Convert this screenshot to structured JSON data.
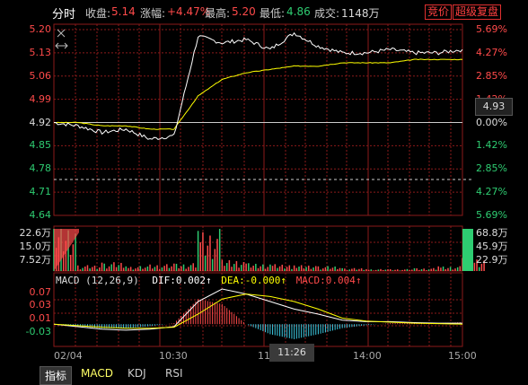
{
  "header": {
    "tab": "分时",
    "close_label": "收盘:",
    "close_value": "5.14",
    "change_label": "涨幅:",
    "change_value": "+4.47%",
    "high_label": "最高:",
    "high_value": "5.20",
    "low_label": "最低:",
    "low_value": "4.86",
    "volume_label": "成交:",
    "volume_value": "1148万",
    "bid_button": "竞价",
    "superlevel_button": "超级复盘"
  },
  "price_axis": {
    "left": [
      "5.20",
      "5.13",
      "5.06",
      "4.99",
      "4.92",
      "4.85",
      "4.78",
      "4.71",
      "4.64"
    ],
    "right": [
      "5.69%",
      "4.27%",
      "2.85%",
      "1.42%",
      "0.00%",
      "1.42%",
      "2.85%",
      "4.27%",
      "5.69%"
    ],
    "right_colors": [
      "#ff4a4a",
      "#ff4a4a",
      "#ff4a4a",
      "#ff4a4a",
      "#dddddd",
      "#2ecc71",
      "#2ecc71",
      "#2ecc71",
      "#2ecc71"
    ],
    "left_colors": [
      "#ff4a4a",
      "#ff4a4a",
      "#ff4a4a",
      "#ff4a4a",
      "#dddddd",
      "#2ecc71",
      "#2ecc71",
      "#2ecc71",
      "#2ecc71"
    ]
  },
  "crosshair_price": "4.93",
  "volume_axis": {
    "left": [
      "22.6万",
      "15.0万",
      "7.52万"
    ],
    "right": [
      "68.8万",
      "45.9万",
      "22.9万"
    ]
  },
  "macd": {
    "title": "MACD (12,26,9)",
    "dif": "DIF:0.002↑",
    "dea": "DEA:-0.000↑",
    "macd": "MACD:0.004↑",
    "axis": [
      "0.07",
      "0.03",
      "0.01",
      "-0.03"
    ],
    "dif_color": "#ffffff",
    "dea_color": "#ffff00",
    "macd_color": "#ff4a4a"
  },
  "time_axis": {
    "labels": [
      "02/04",
      "10:30",
      "14:00",
      "15:00"
    ],
    "hover_time": "11:26",
    "hover_partial": "11"
  },
  "bottom_tabs": [
    "指标",
    "MACD",
    "KDJ",
    "RSI"
  ],
  "colors": {
    "up": "#ff4a4a",
    "down": "#2ecc71",
    "grid": "#8b1a1a",
    "price_line": "#ffffff",
    "avg_line": "#ffff00"
  },
  "chart_data": [
    {
      "type": "line",
      "title": "分时",
      "xlabel": "",
      "ylabel": "",
      "ylim": [
        4.64,
        5.2
      ],
      "x": [
        "09:30",
        "09:35",
        "09:40",
        "09:45",
        "09:50",
        "09:55",
        "10:00",
        "10:05",
        "10:10",
        "10:15",
        "10:20",
        "10:30",
        "11:00",
        "11:30",
        "13:30",
        "14:00",
        "14:30",
        "15:00"
      ],
      "series": [
        {
          "values": [
            4.92,
            4.92,
            4.92,
            4.92,
            4.92,
            4.92,
            4.92,
            4.92,
            4.92,
            4.92,
            4.92,
            4.92,
            4.92,
            4.92,
            4.92,
            4.92,
            4.92,
            4.92
          ]
        },
        {
          "values": [
            4.92,
            4.91,
            4.89,
            4.9,
            4.87,
            4.88,
            5.18,
            5.16,
            5.17,
            5.14,
            5.19,
            5.15,
            5.13,
            5.13,
            5.14,
            5.13,
            5.13,
            5.14
          ]
        },
        {
          "values": [
            4.92,
            4.92,
            4.91,
            4.91,
            4.9,
            4.9,
            5.0,
            5.05,
            5.07,
            5.08,
            5.09,
            5.09,
            5.1,
            5.1,
            5.1,
            5.11,
            5.11,
            5.11
          ]
        }
      ]
    },
    {
      "type": "bar",
      "title": "",
      "ylim": [
        0,
        22.6
      ],
      "ylabel": "万",
      "x": [
        "09:30",
        "09:35",
        "09:40",
        "09:45",
        "09:50",
        "09:55",
        "10:00",
        "10:05",
        "10:10",
        "10:15",
        "10:20",
        "10:30",
        "11:00",
        "11:30",
        "13:30",
        "14:00",
        "14:30",
        "15:00"
      ],
      "values": [
        22.6,
        3.0,
        4.5,
        2.5,
        3.5,
        4.0,
        21.5,
        6.0,
        4.0,
        3.5,
        3.0,
        2.5,
        1.5,
        1.0,
        1.0,
        1.5,
        2.5,
        7.0
      ]
    },
    {
      "type": "bar",
      "title": "MACD (12,26,9)",
      "ylim": [
        -0.03,
        0.07
      ],
      "x": [
        "09:30",
        "09:35",
        "09:40",
        "09:45",
        "09:50",
        "09:55",
        "10:00",
        "10:05",
        "10:10",
        "10:15",
        "10:20",
        "10:30",
        "11:00",
        "11:30",
        "13:30",
        "14:00",
        "14:30",
        "15:00"
      ],
      "series": [
        {
          "name": "DIF",
          "values": [
            0.0,
            -0.005,
            -0.01,
            -0.012,
            -0.01,
            -0.005,
            0.045,
            0.07,
            0.06,
            0.045,
            0.03,
            0.02,
            0.008,
            0.005,
            0.005,
            0.003,
            0.002,
            0.002
          ]
        },
        {
          "name": "DEA",
          "values": [
            0.0,
            -0.003,
            -0.006,
            -0.008,
            -0.008,
            -0.006,
            0.02,
            0.05,
            0.06,
            0.055,
            0.045,
            0.03,
            0.012,
            0.006,
            0.004,
            0.002,
            0.001,
            0.0
          ]
        },
        {
          "name": "MACD",
          "values": [
            0.0,
            -0.004,
            -0.008,
            -0.008,
            -0.004,
            0.002,
            0.05,
            0.04,
            0.0,
            -0.02,
            -0.03,
            -0.02,
            -0.008,
            -0.002,
            0.002,
            0.002,
            0.002,
            0.004
          ]
        }
      ]
    }
  ]
}
